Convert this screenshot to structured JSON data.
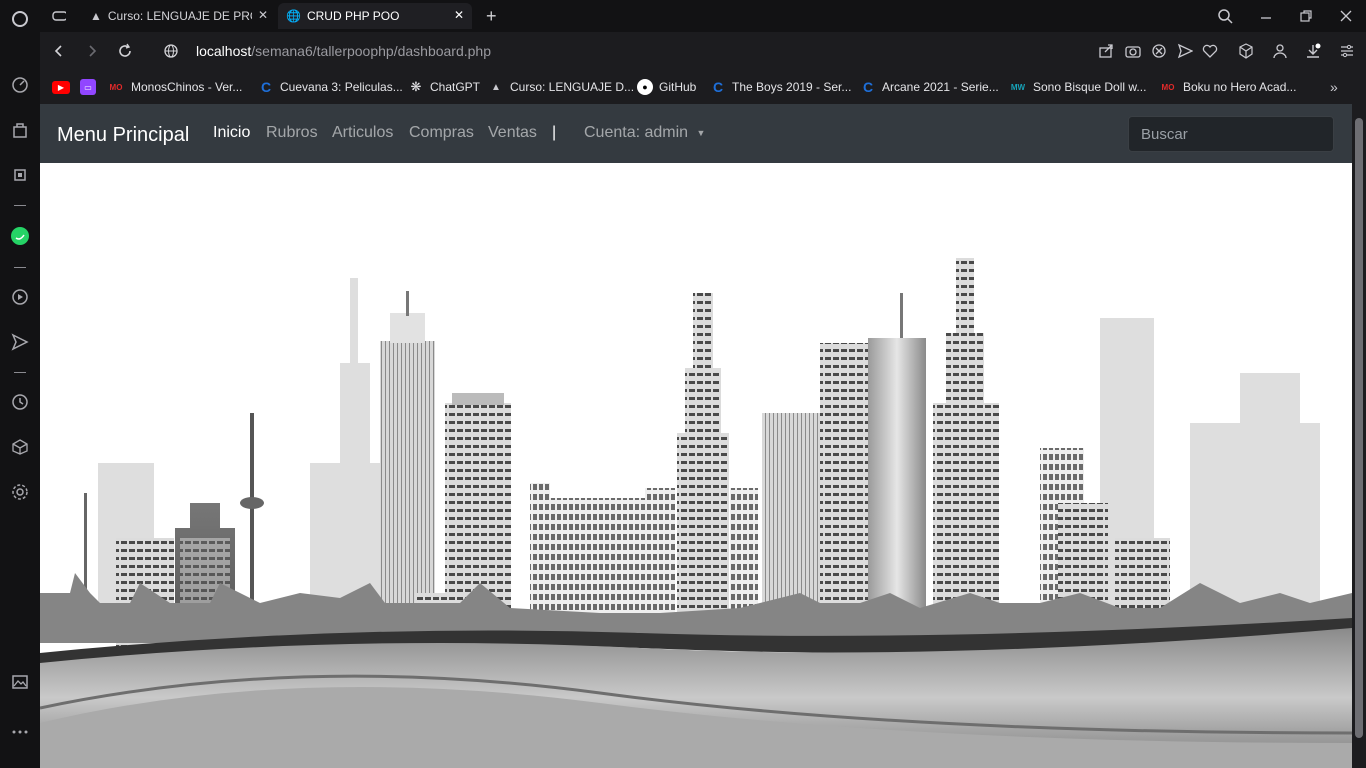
{
  "browser": {
    "tabs": [
      {
        "title": "Curso: LENGUAJE DE PROG",
        "icon": "hat-icon"
      },
      {
        "title": "CRUD PHP POO",
        "icon": "globe-icon"
      }
    ],
    "address": {
      "host": "localhost",
      "path": "/semana6/tallerpoophp/dashboard.php"
    },
    "bookmarks": [
      {
        "label": "",
        "icon": "youtube-icon",
        "color": "#ff0000"
      },
      {
        "label": "",
        "icon": "twitch-icon",
        "color": "#9146ff"
      },
      {
        "label": "MonosChinos - Ver...",
        "icon": "mo-icon",
        "color": "#e32a2a"
      },
      {
        "label": "Cuevana 3: Peliculas...",
        "icon": "c-icon",
        "color": "#1e6fd9"
      },
      {
        "label": "ChatGPT",
        "icon": "openai-icon",
        "color": "#e4e4e7"
      },
      {
        "label": "Curso: LENGUAJE D...",
        "icon": "hat-icon",
        "color": "#e4e4e7"
      },
      {
        "label": "GitHub",
        "icon": "github-icon",
        "color": "#ffffff"
      },
      {
        "label": "The Boys 2019 - Ser...",
        "icon": "c-icon",
        "color": "#1e6fd9"
      },
      {
        "label": "Arcane 2021 - Serie...",
        "icon": "c-icon",
        "color": "#1e6fd9"
      },
      {
        "label": "Sono Bisque Doll w...",
        "icon": "mw-icon",
        "color": "#17a2b8"
      },
      {
        "label": "Boku no Hero Acad...",
        "icon": "mo-icon",
        "color": "#e32a2a"
      }
    ]
  },
  "app": {
    "brand": "Menu Principal",
    "nav": [
      "Inicio",
      "Rubros",
      "Articulos",
      "Compras",
      "Ventas"
    ],
    "separator": "|",
    "account": "Cuenta: admin",
    "search_placeholder": "Buscar"
  },
  "colors": {
    "navbar": "#343a40",
    "page": "#ffffff",
    "browser": "#1c1c1f"
  }
}
